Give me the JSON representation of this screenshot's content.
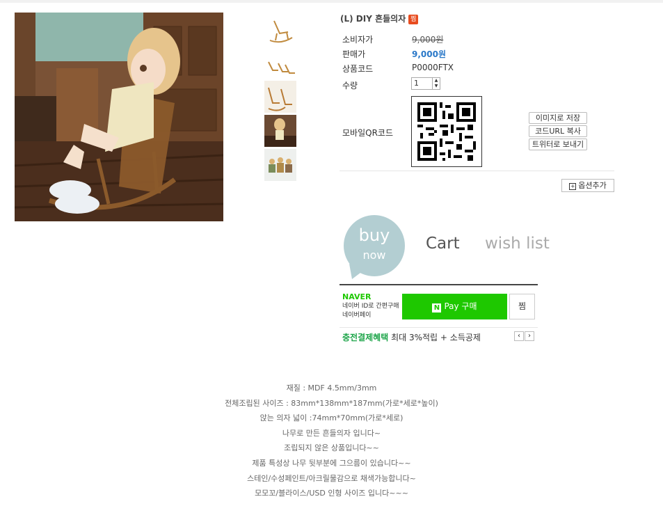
{
  "product": {
    "title": "(L) DIY 흔들의자",
    "zzim_badge": "찜",
    "fields": {
      "consumer_price_label": "소비자가",
      "consumer_price": "9,000원",
      "sale_price_label": "판매가",
      "sale_price": "9,000원",
      "code_label": "상품코드",
      "code": "P0000FTX",
      "qty_label": "수량",
      "qty": "1",
      "qr_label": "모바일QR코드"
    },
    "share_buttons": [
      "이미지로 저장",
      "코드URL 복사",
      "트위터로 보내기"
    ],
    "option_button": "옵션추가",
    "option_icon": "plus-box-icon"
  },
  "actions": {
    "buy_top": "buy",
    "buy_bottom": "now",
    "cart": "Cart",
    "wishlist": "wish list"
  },
  "npay": {
    "brand": "NAVER",
    "sub1": "네이버 ID로 간편구매",
    "sub2": "네이버페이",
    "pay_logo": "N",
    "pay_label": "Pay 구매",
    "zzim": "찜",
    "benefit_strong": "충전결제혜택",
    "benefit_text": "최대 3%적립 + 소득공제",
    "prev": "‹",
    "next": "›"
  },
  "colors": {
    "accent_price": "#2a78c8",
    "npay_green": "#1ec800",
    "buy_circle": "#b3ced2"
  },
  "description": [
    "재질 : MDF 4.5mm/3mm",
    "전체조립된 사이즈 : 83mm*138mm*187mm(가로*세로*높이)",
    "앉는 의자 넓이 :74mm*70mm(가로*세로)",
    "나무로 만든 흔들의자 입니다~",
    "조립되지 않은 상품입니다~~",
    "제품 특성상 나무 뒷부분에 그으름이 있습니다~~",
    "스테인/수성페인트/아크릴물감으로 채색가능합니다~",
    "모모꼬/블라이스/USD 인형 사이즈 입니다~~~"
  ]
}
